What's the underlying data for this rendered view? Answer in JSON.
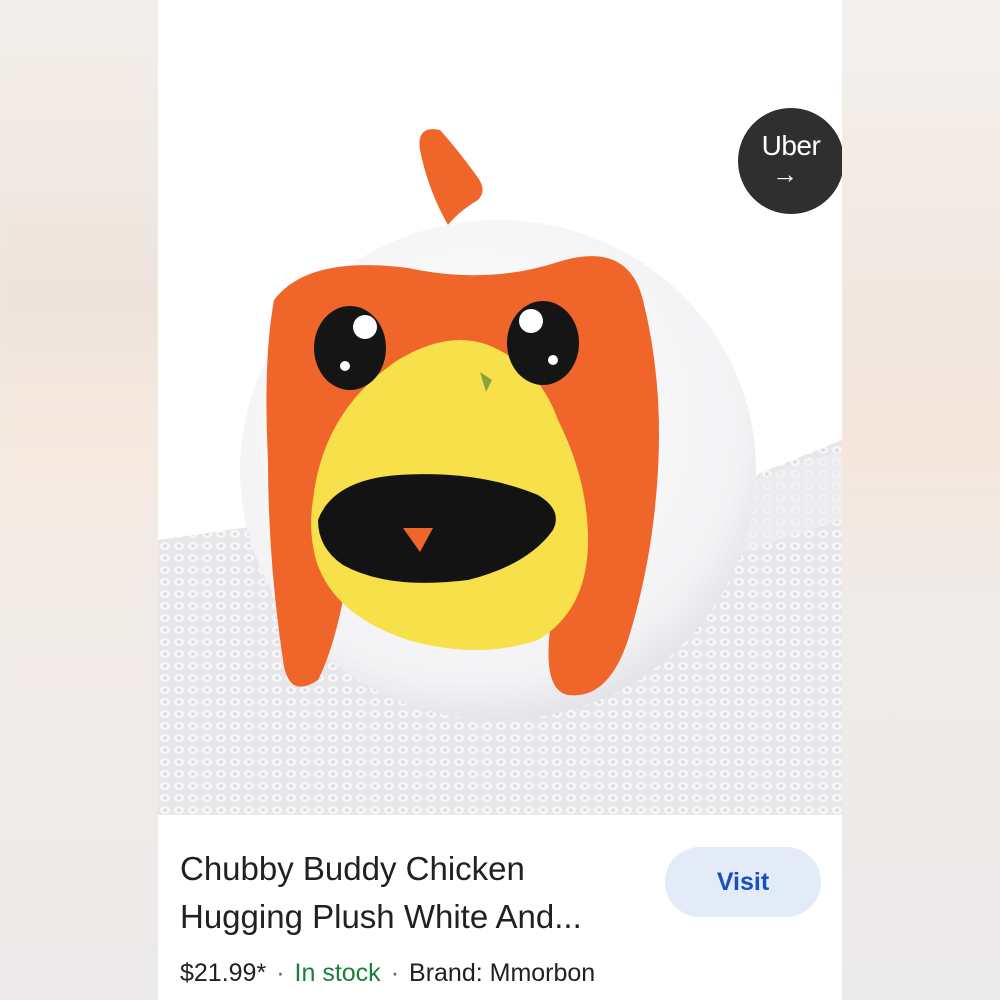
{
  "badge": {
    "label": "Uber",
    "arrow": "→",
    "icon": "arrow-right-icon"
  },
  "product": {
    "title_line1": "Chubby Buddy Chicken",
    "title_line2": "Hugging Plush White And...",
    "price": "$21.99*",
    "separator": "·",
    "stock": "In stock",
    "brand": "Brand: Mmorbon"
  },
  "actions": {
    "visit_label": "Visit"
  },
  "colors": {
    "stock_green": "#188038",
    "visit_bg": "#e3eaf8",
    "visit_text": "#1a4fbf",
    "badge_bg": "#2f2f2f",
    "plush_orange": "#f0662a",
    "plush_yellow": "#f7e04a"
  }
}
